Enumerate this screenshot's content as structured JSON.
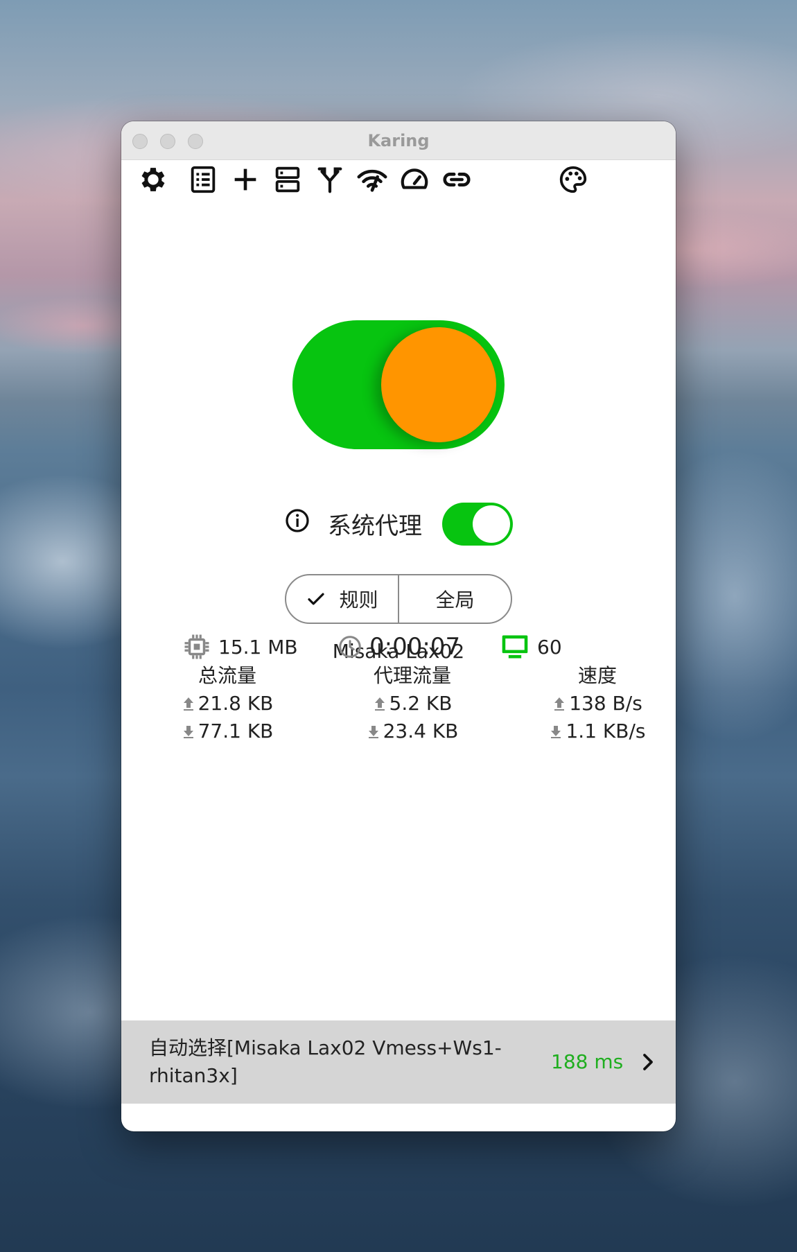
{
  "window": {
    "title": "Karing"
  },
  "toolbar": {
    "icons": [
      "gear-icon",
      "list-icon",
      "plus-icon",
      "server-icon",
      "fork-icon",
      "speed-signal-icon",
      "speedometer-icon",
      "link-icon",
      "palette-icon"
    ]
  },
  "main": {
    "system_proxy_label": "系统代理",
    "system_proxy_on": true,
    "connection_on": true,
    "mode": {
      "rule_label": "规则",
      "global_label": "全局",
      "selected": "rule"
    },
    "server_name": "Misaka Lax02"
  },
  "stats": {
    "memory": "15.1 MB",
    "uptime": "0:00:07",
    "connections": "60",
    "total": {
      "label": "总流量",
      "up": "21.8 KB",
      "down": "77.1 KB"
    },
    "proxy": {
      "label": "代理流量",
      "up": "5.2 KB",
      "down": "23.4 KB"
    },
    "speed": {
      "label": "速度",
      "up": "138 B/s",
      "down": "1.1 KB/s"
    }
  },
  "footer": {
    "selection": "自动选择[Misaka Lax02 Vmess+Ws1-rhitan3x]",
    "latency": "188 ms"
  },
  "colors": {
    "accent_green": "#07c410",
    "knob_orange": "#ff9500",
    "latency_green": "#1fae1f",
    "footer_bg": "#d5d5d5"
  }
}
